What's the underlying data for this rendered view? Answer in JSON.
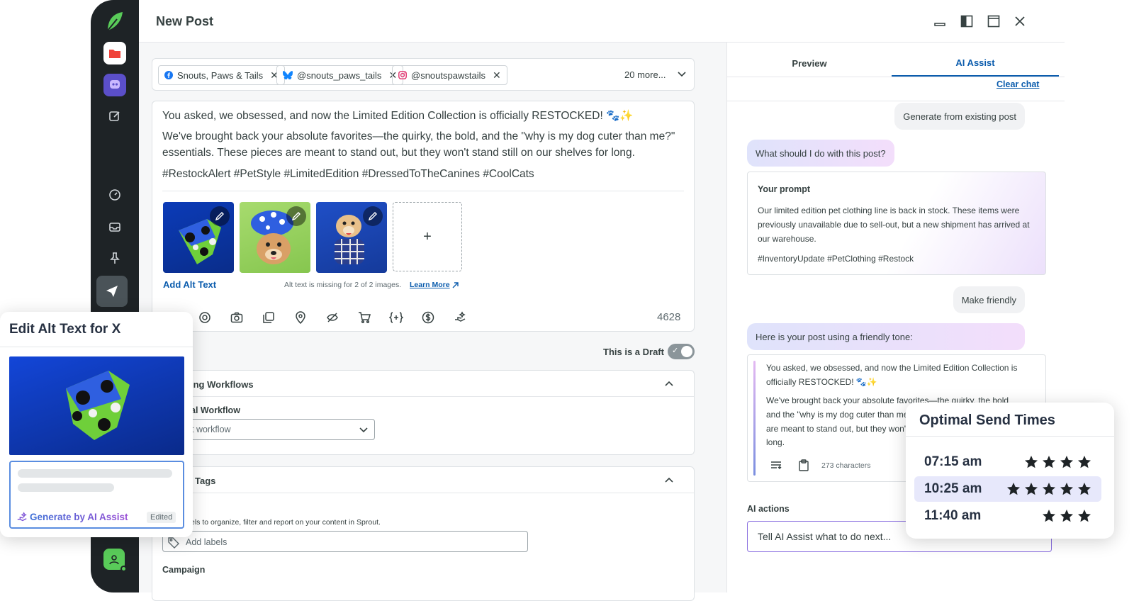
{
  "window": {
    "title": "New Post"
  },
  "profiles": [
    {
      "name": "Snouts, Paws & Tails",
      "network": "facebook",
      "color": "#1877f2"
    },
    {
      "name": "@snouts_paws_tails",
      "network": "bluesky",
      "color": "#1185fe"
    },
    {
      "name": "@snoutspawstails",
      "network": "instagram",
      "color": "#e1306c"
    }
  ],
  "profiles_more": "20 more...",
  "post": {
    "line1": "You asked, we obsessed, and now the Limited Edition Collection is officially RESTOCKED! 🐾✨",
    "line2": "We've brought back your absolute favorites—the quirky, the bold, and the \"why is my dog cuter than me?\" essentials. These pieces are meant to stand out, but they won't stand still on our shelves for long.",
    "hashtags": "#RestockAlert #PetStyle #LimitedEdition #DressedToTheCanines #CoolCats"
  },
  "media": {
    "add_alt_text": "Add Alt Text",
    "alt_missing": "Alt text is missing for 2 of 2 images.",
    "learn_more": "Learn More",
    "add_symbol": "+"
  },
  "toolbar": {
    "char_count": "4628"
  },
  "draft": {
    "label": "This is a Draft",
    "on": true
  },
  "workflows": {
    "section_title": "ing Workflows",
    "field_label": "al Workflow",
    "select_value": "t workflow"
  },
  "tags": {
    "section_title": "Tags",
    "description": "els to organize, filter and report on your content in Sprout.",
    "placeholder": "Add labels"
  },
  "campaign": {
    "label": "Campaign"
  },
  "tabs": {
    "preview": "Preview",
    "ai_assist": "AI Assist"
  },
  "ai": {
    "clear_chat": "Clear chat",
    "msg_generate": "Generate from existing post",
    "msg_question": "What should I do with this post?",
    "prompt_title": "Your prompt",
    "prompt_body": "Our limited edition pet clothing line is back in stock. These items were previously unavailable due to sell-out, but a new shipment has arrived at our warehouse.",
    "prompt_tags": "#InventoryUpdate #PetClothing #Restock",
    "msg_friendly": "Make friendly",
    "msg_response": "Here is your post using a friendly tone:",
    "resp_line1": "You asked, we obsessed, and now the Limited Edition Collection is officially RESTOCKED! 🐾✨",
    "resp_line2a": "We've brought back your absolute favorites—the quirky, the bold",
    "resp_line2b": "and the \"why is my dog cuter than me?\"",
    "resp_line2c": "are meant to stand out, but they won't s",
    "resp_line2d": "long.",
    "resp_chars": "273 characters",
    "actions_label": "AI actions",
    "input_placeholder": "Tell AI Assist what to do next..."
  },
  "alt_panel": {
    "title": "Edit Alt Text for X",
    "generate": "Generate by AI Assist",
    "edited": "Edited"
  },
  "send_times": {
    "title": "Optimal Send Times",
    "rows": [
      {
        "time": "07:15 am",
        "stars": 4
      },
      {
        "time": "10:25 am",
        "stars": 5,
        "highlighted": true
      },
      {
        "time": "11:40 am",
        "stars": 3
      }
    ]
  },
  "colors": {
    "accent": "#0b5cad",
    "rail": "#1e2326",
    "brand_green": "#59cb59",
    "ai_purple": "#7b4fd6"
  }
}
